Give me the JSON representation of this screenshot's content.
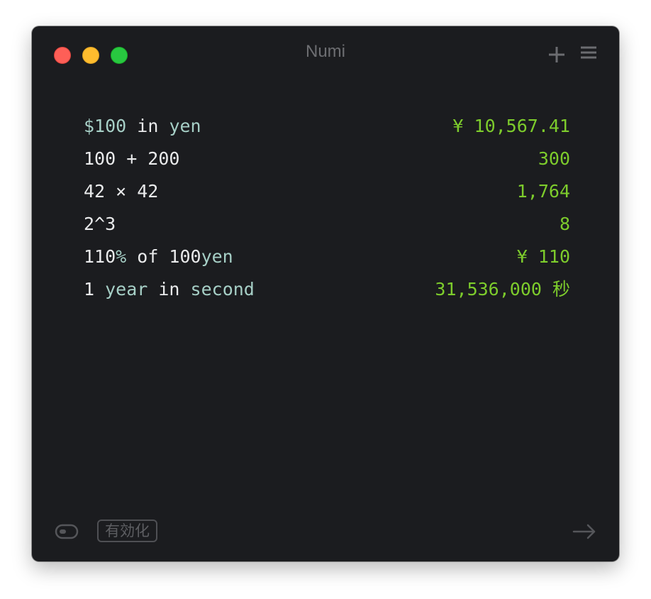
{
  "window": {
    "title": "Numi"
  },
  "icons": {
    "close": "close-button",
    "minimize": "minimize-button",
    "zoom": "zoom-button",
    "add": "plus-icon",
    "menu": "hamburger-menu-icon",
    "toggle": "toggle-icon",
    "export": "arrow-right-icon"
  },
  "lines": [
    {
      "tokens": [
        {
          "text": "$100",
          "kind": "unit"
        },
        {
          "text": " in ",
          "kind": "text"
        },
        {
          "text": "yen",
          "kind": "unit"
        }
      ],
      "result": "¥ 10,567.41"
    },
    {
      "tokens": [
        {
          "text": "100 + 200",
          "kind": "text"
        }
      ],
      "result": "300"
    },
    {
      "tokens": [
        {
          "text": "42 × 42",
          "kind": "text"
        }
      ],
      "result": "1,764"
    },
    {
      "tokens": [
        {
          "text": "2^3",
          "kind": "text"
        }
      ],
      "result": "8"
    },
    {
      "tokens": [
        {
          "text": "110",
          "kind": "text"
        },
        {
          "text": "%",
          "kind": "unit"
        },
        {
          "text": " of 100",
          "kind": "text"
        },
        {
          "text": "yen",
          "kind": "unit"
        }
      ],
      "result": "¥ 110"
    },
    {
      "tokens": [
        {
          "text": "1 ",
          "kind": "text"
        },
        {
          "text": "year",
          "kind": "unit"
        },
        {
          "text": " in ",
          "kind": "text"
        },
        {
          "text": "second",
          "kind": "unit"
        }
      ],
      "result": "31,536,000 秒"
    }
  ],
  "footer": {
    "enable_label": "有効化"
  },
  "colors": {
    "background": "#1b1c1f",
    "text": "#e9eaeb",
    "unit": "#a6cfc6",
    "result": "#7dcc2c",
    "muted": "#6d6e72"
  }
}
